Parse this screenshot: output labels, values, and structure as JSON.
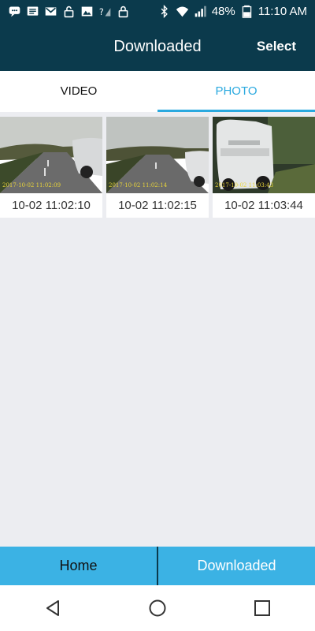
{
  "status_bar": {
    "left_icons": [
      "chat-icon",
      "message-icon",
      "gmail-icon",
      "lock-open-icon",
      "image-icon",
      "signal-question-icon",
      "lock-icon"
    ],
    "battery": "48%",
    "time": "11:10 AM"
  },
  "header": {
    "title": "Downloaded",
    "action": "Select"
  },
  "tabs": [
    {
      "label": "VIDEO",
      "active": false
    },
    {
      "label": "PHOTO",
      "active": true
    }
  ],
  "photos": [
    {
      "caption": "10-02 11:02:10",
      "stamp": "2017-10-02 11:02:09"
    },
    {
      "caption": "10-02 11:02:15",
      "stamp": "2017-10-02 11:02:14"
    },
    {
      "caption": "10-02 11:03:44",
      "stamp": "2017-10-02 11:03:43"
    }
  ],
  "bottom_nav": {
    "home": "Home",
    "downloaded": "Downloaded"
  },
  "colors": {
    "header_bg": "#0b3a4c",
    "accent": "#2aa9df",
    "bottom_nav_bg": "#3bb2e4"
  }
}
